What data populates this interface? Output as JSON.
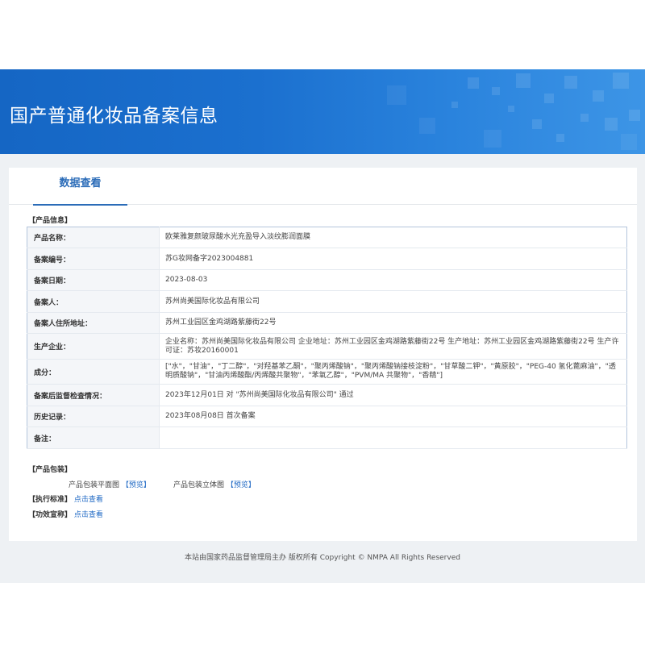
{
  "header": {
    "title": "国产普通化妆品备案信息"
  },
  "tabs": [
    {
      "label": "数据查看"
    }
  ],
  "product_info": {
    "section_title": "【产品信息】",
    "rows": [
      {
        "label": "产品名称：",
        "value": "欧莱雅复颜玻尿酸水光充盈导入淡纹膨润面膜"
      },
      {
        "label": "备案编号：",
        "value": "苏G妆网备字2023004881"
      },
      {
        "label": "备案日期：",
        "value": "2023-08-03"
      },
      {
        "label": "备案人：",
        "value": "苏州尚美国际化妆品有限公司"
      },
      {
        "label": "备案人住所地址：",
        "value": "苏州工业园区金鸡湖路紫藤街22号"
      },
      {
        "label": "生产企业：",
        "value": "企业名称：苏州尚美国际化妆品有限公司 企业地址：苏州工业园区金鸡湖路紫藤街22号 生产地址：苏州工业园区金鸡湖路紫藤街22号 生产许可证：苏妆20160001"
      },
      {
        "label": "成分：",
        "value": "[\"水\"，\"甘油\"，\"丁二醇\"，\"对羟基苯乙酮\"，\"聚丙烯酸钠\"，\"聚丙烯酸钠接枝淀粉\"，\"甘草酸二钾\"，\"黄原胶\"，\"PEG-40 氢化蓖麻油\"，\"透明质酸钠\"，\"甘油丙烯酸酯/丙烯酸共聚物\"，\"苯氧乙醇\"，\"PVM/MA 共聚物\"，\"香精\"]"
      },
      {
        "label": "备案后监督检查情况：",
        "value": "2023年12月01日 对 \"苏州尚美国际化妆品有限公司\" 通过"
      },
      {
        "label": "历史记录：",
        "value": "2023年08月08日 首次备案"
      },
      {
        "label": "备注：",
        "value": ""
      }
    ]
  },
  "packaging": {
    "section_title": "【产品包装】",
    "flat_label": "产品包装平面图",
    "flat_link": "【预览】",
    "stereo_label": "产品包装立体图",
    "stereo_link": "【预览】"
  },
  "standard": {
    "label": "【执行标准】",
    "link": "点击查看"
  },
  "efficacy": {
    "label": "【功效宣称】",
    "link": "点击查看"
  },
  "footer": {
    "text": "本站由国家药品监督管理局主办 版权所有 Copyright © NMPA All Rights Reserved"
  }
}
